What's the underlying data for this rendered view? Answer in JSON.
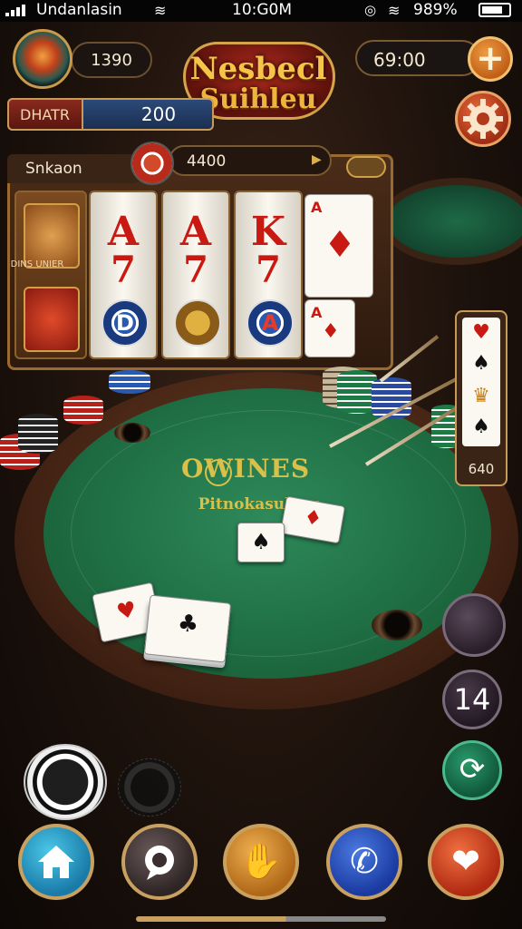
{
  "status_bar": {
    "carrier": "Undanlasin",
    "time": "10:G0M",
    "battery_percent": "989%"
  },
  "header": {
    "player_coins": "1390",
    "logo_line1": "Nesbecl",
    "logo_line2": "Suihleu",
    "timer": "69:00",
    "bet_label": "DHATR",
    "bet_value": "200"
  },
  "slot_panel": {
    "title": "Snkaon",
    "amount": "4400",
    "side_tile_label": "DINS UNIER",
    "reels": [
      {
        "top": "A",
        "mid": "7"
      },
      {
        "top": "A",
        "mid": "7"
      },
      {
        "top": "K",
        "mid": "7"
      }
    ],
    "reel_chip_letters": [
      "D",
      "",
      "A"
    ]
  },
  "table": {
    "felt_title": "OWINES",
    "felt_subtitle": "Pitnokasulhes"
  },
  "side_panel": {
    "value": "640"
  },
  "controls": {
    "round_number": "14"
  },
  "icons": {
    "home": "home-icon",
    "chat": "chat-icon",
    "hand": "hand-icon",
    "phone": "phone-icon",
    "gift": "gift-icon",
    "settings": "gear-icon",
    "add": "plus-icon",
    "sync": "sync-icon"
  }
}
